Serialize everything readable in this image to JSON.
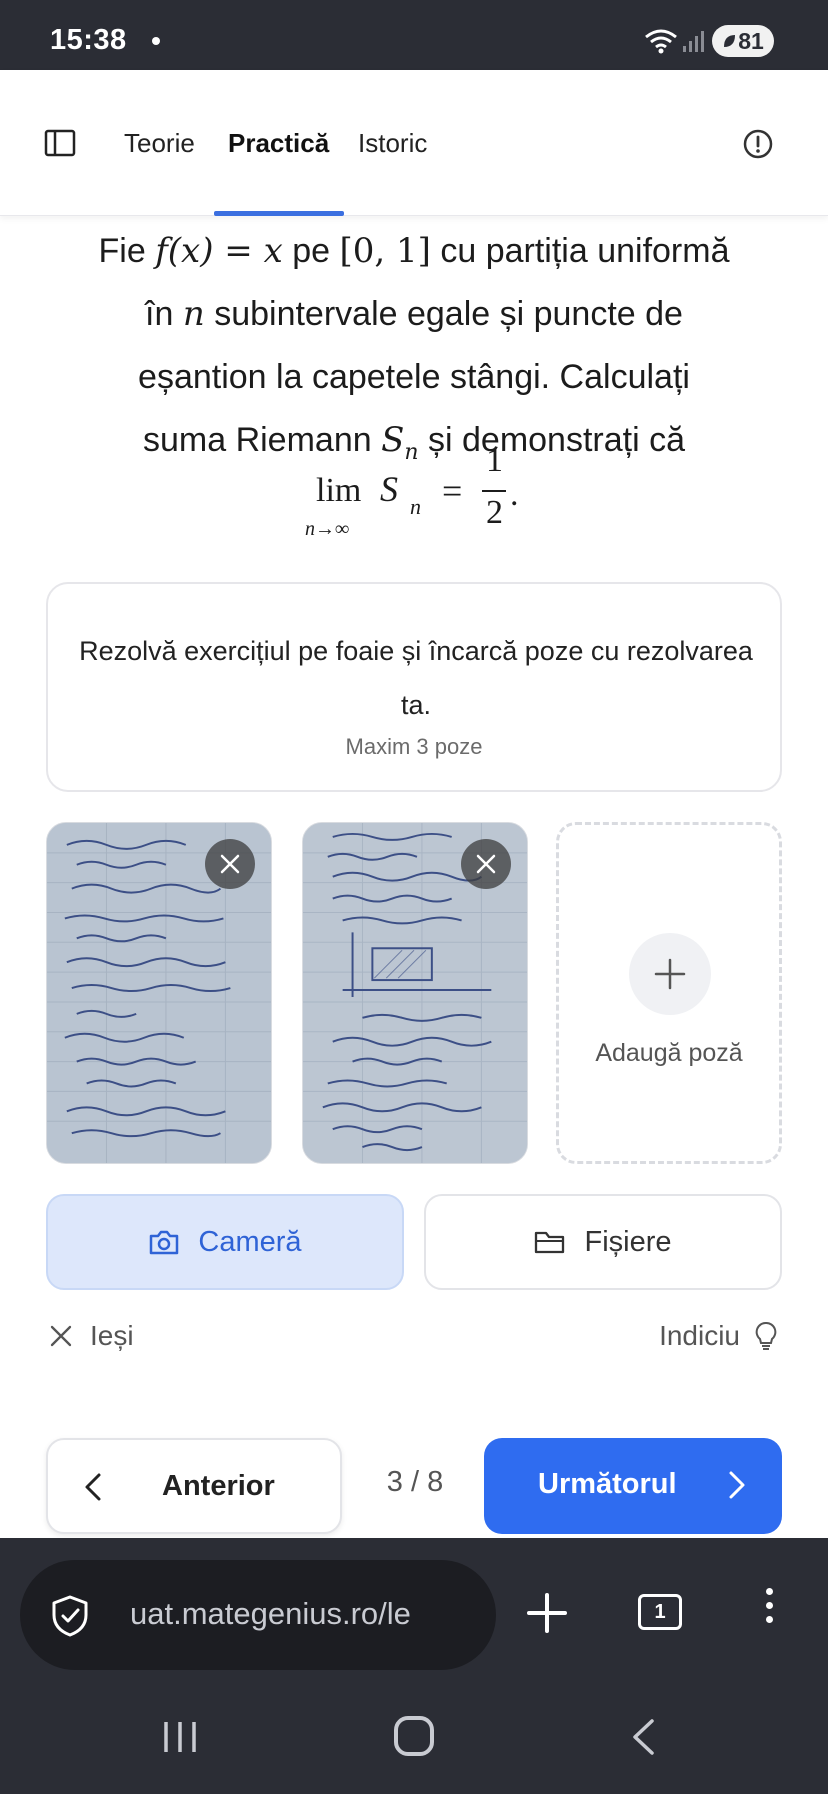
{
  "status_bar": {
    "time": "15:38",
    "battery": "81"
  },
  "nav": {
    "tabs": [
      {
        "label": "Teorie",
        "active": false
      },
      {
        "label": "Practică",
        "active": true
      },
      {
        "label": "Istoric",
        "active": false
      }
    ],
    "accent_color": "#3b6fe0"
  },
  "problem": {
    "line1_prefix": "Fie ",
    "line1_f": "f(x) = x",
    "line1_mid": " pe ",
    "line1_interval": "[0, 1]",
    "line1_suffix": " cu partiția uniformă",
    "line2_prefix": "în ",
    "line2_n": "n",
    "line2_suffix": " subintervale egale și puncte de",
    "line3": "eșantion la capetele stângi. Calculați",
    "line4_prefix": "suma Riemann ",
    "line4_S": "S",
    "line4_n": "n",
    "line4_suffix": " și demonstrați că",
    "limit": {
      "lim": "lim",
      "sub": "n→∞",
      "S": "S",
      "n": "n",
      "eq": "=",
      "num": "1",
      "den": "2",
      "end": "."
    }
  },
  "upload_box": {
    "instruction": "Rezolvă exercițiul pe foaie și încarcă poze cu rezolvarea ta.",
    "limit_text": "Maxim 3 poze"
  },
  "photos": [
    {
      "alt": "handwritten solution page 1"
    },
    {
      "alt": "handwritten solution page 2"
    }
  ],
  "add_photo_label": "Adaugă poză",
  "buttons": {
    "camera": "Cameră",
    "files": "Fișiere",
    "exit": "Ieși",
    "hint": "Indiciu",
    "prev": "Anterior",
    "next": "Următorul",
    "primary_color": "#2f6cf0"
  },
  "progress": {
    "current": 3,
    "total": 8,
    "text": "3 / 8"
  },
  "browser": {
    "url": "uat.mategenius.ro/le",
    "tab_count": "1"
  }
}
